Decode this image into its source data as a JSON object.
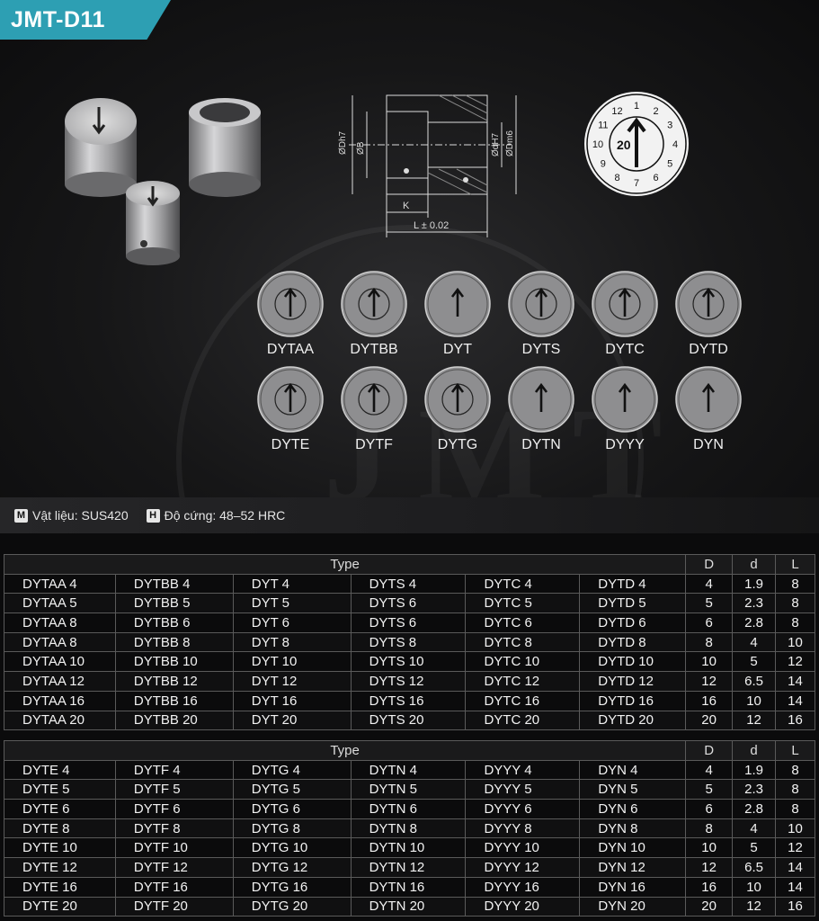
{
  "header": {
    "title": "JMT-D11"
  },
  "drawing": {
    "labels": [
      "ØDh7",
      "ØB",
      "ØdH7",
      "ØDm6",
      "K",
      "L ± 0.02"
    ]
  },
  "big_dial": {
    "center": "20",
    "ring": [
      "1",
      "2",
      "3",
      "4",
      "5",
      "6",
      "7",
      "8",
      "9",
      "10",
      "11",
      "12"
    ]
  },
  "stamps": [
    {
      "name": "DYTAA"
    },
    {
      "name": "DYTBB"
    },
    {
      "name": "DYT"
    },
    {
      "name": "DYTS"
    },
    {
      "name": "DYTC"
    },
    {
      "name": "DYTD"
    },
    {
      "name": "DYTE"
    },
    {
      "name": "DYTF"
    },
    {
      "name": "DYTG"
    },
    {
      "name": "DYTN"
    },
    {
      "name": "DYYY"
    },
    {
      "name": "DYN"
    }
  ],
  "specs": {
    "material_key": "M",
    "material": "Vật liệu: SUS420",
    "hardness_key": "H",
    "hardness": "Độ cứng: 48–52 HRC"
  },
  "table1": {
    "headers": [
      "Type",
      "D",
      "d",
      "L"
    ],
    "rows": [
      [
        "DYTAA 4",
        "DYTBB 4",
        "DYT 4",
        "DYTS 4",
        "DYTC 4",
        "DYTD 4",
        "4",
        "1.9",
        "8"
      ],
      [
        "DYTAA 5",
        "DYTBB 5",
        "DYT 5",
        "DYTS 6",
        "DYTC 5",
        "DYTD 5",
        "5",
        "2.3",
        "8"
      ],
      [
        "DYTAA 8",
        "DYTBB 6",
        "DYT 6",
        "DYTS 6",
        "DYTC 6",
        "DYTD 6",
        "6",
        "2.8",
        "8"
      ],
      [
        "DYTAA 8",
        "DYTBB 8",
        "DYT 8",
        "DYTS 8",
        "DYTC 8",
        "DYTD 8",
        "8",
        "4",
        "10"
      ],
      [
        "DYTAA 10",
        "DYTBB 10",
        "DYT 10",
        "DYTS 10",
        "DYTC 10",
        "DYTD 10",
        "10",
        "5",
        "12"
      ],
      [
        "DYTAA 12",
        "DYTBB 12",
        "DYT 12",
        "DYTS 12",
        "DYTC 12",
        "DYTD 12",
        "12",
        "6.5",
        "14"
      ],
      [
        "DYTAA 16",
        "DYTBB 16",
        "DYT 16",
        "DYTS 16",
        "DYTC 16",
        "DYTD 16",
        "16",
        "10",
        "14"
      ],
      [
        "DYTAA 20",
        "DYTBB 20",
        "DYT 20",
        "DYTS 20",
        "DYTC 20",
        "DYTD 20",
        "20",
        "12",
        "16"
      ]
    ]
  },
  "table2": {
    "headers": [
      "Type",
      "D",
      "d",
      "L"
    ],
    "rows": [
      [
        "DYTE 4",
        "DYTF 4",
        "DYTG 4",
        "DYTN 4",
        "DYYY 4",
        "DYN 4",
        "4",
        "1.9",
        "8"
      ],
      [
        "DYTE 5",
        "DYTF 5",
        "DYTG 5",
        "DYTN 5",
        "DYYY 5",
        "DYN 5",
        "5",
        "2.3",
        "8"
      ],
      [
        "DYTE 6",
        "DYTF 6",
        "DYTG 6",
        "DYTN 6",
        "DYYY 6",
        "DYN 6",
        "6",
        "2.8",
        "8"
      ],
      [
        "DYTE 8",
        "DYTF 8",
        "DYTG 8",
        "DYTN 8",
        "DYYY 8",
        "DYN 8",
        "8",
        "4",
        "10"
      ],
      [
        "DYTE 10",
        "DYTF 10",
        "DYTG 10",
        "DYTN 10",
        "DYYY 10",
        "DYN 10",
        "10",
        "5",
        "12"
      ],
      [
        "DYTE 12",
        "DYTF 12",
        "DYTG 12",
        "DYTN 12",
        "DYYY 12",
        "DYN 12",
        "12",
        "6.5",
        "14"
      ],
      [
        "DYTE 16",
        "DYTF 16",
        "DYTG 16",
        "DYTN 16",
        "DYYY 16",
        "DYN 16",
        "16",
        "10",
        "14"
      ],
      [
        "DYTE 20",
        "DYTF 20",
        "DYTG 20",
        "DYTN 20",
        "DYYY 20",
        "DYN 20",
        "20",
        "12",
        "16"
      ]
    ]
  },
  "colors": {
    "accent": "#2d9fb3",
    "background": "#0b0b0c",
    "stamp_face": "#8e8e90"
  }
}
